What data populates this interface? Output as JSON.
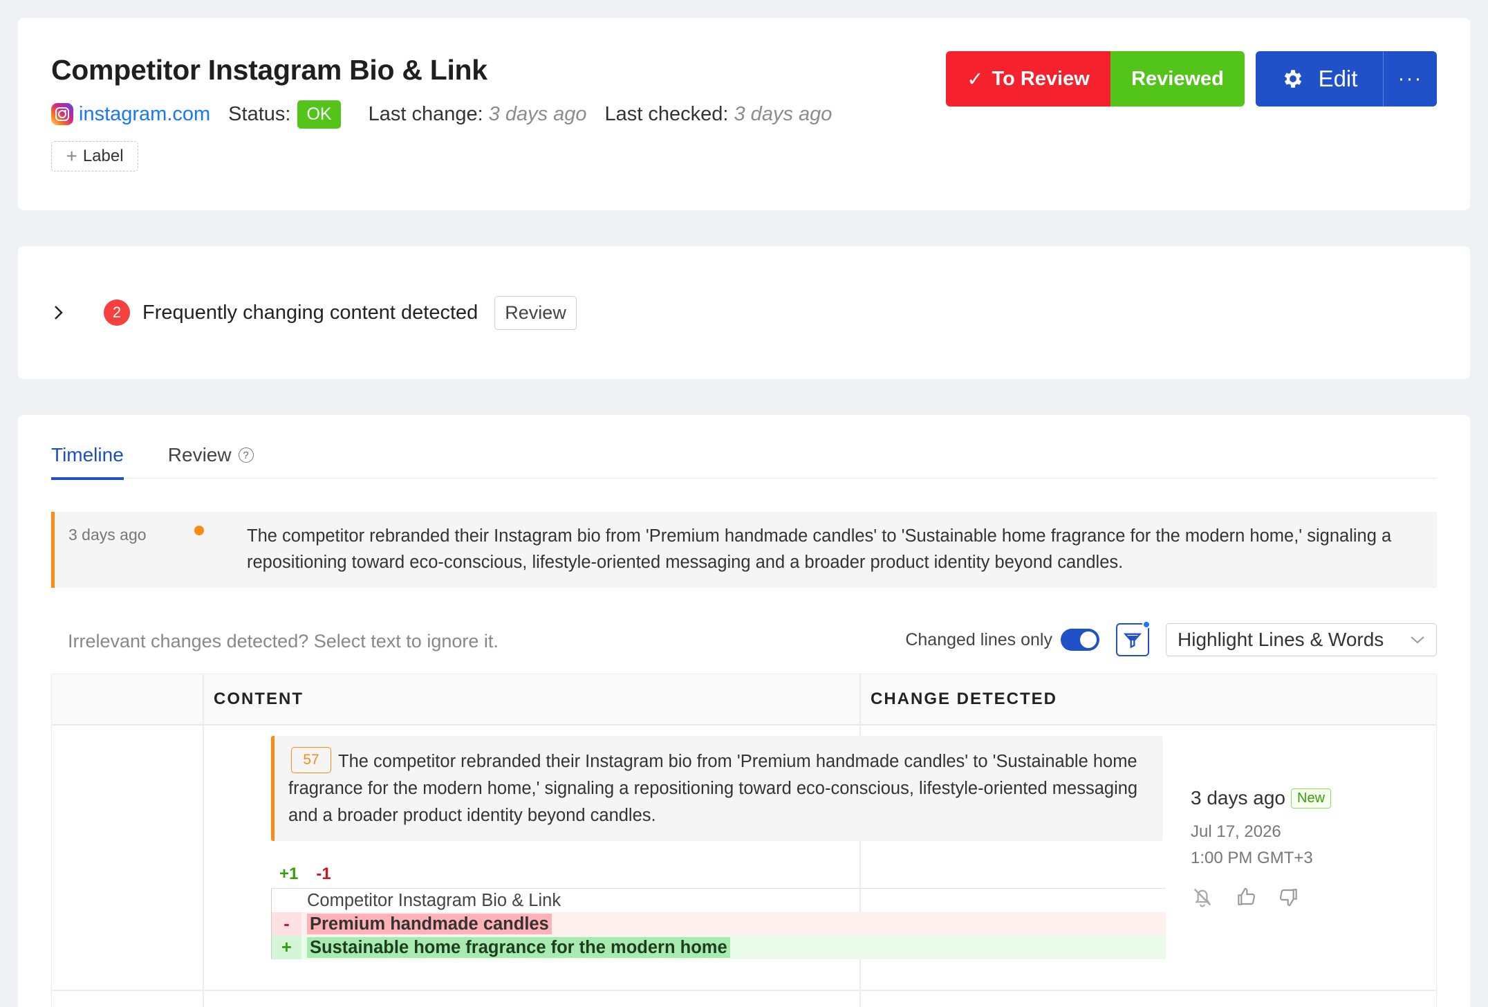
{
  "header": {
    "title": "Competitor Instagram Bio & Link",
    "site": "instagram.com",
    "status_label": "Status:",
    "status_value": "OK",
    "last_change_label": "Last change:",
    "last_change_value": "3 days ago",
    "last_checked_label": "Last checked:",
    "last_checked_value": "3 days ago",
    "label_button": "Label",
    "to_review_label": "To Review",
    "reviewed_label": "Reviewed",
    "edit_label": "Edit",
    "more_label": "···"
  },
  "warning": {
    "count": "2",
    "text": "Frequently changing content detected",
    "review_button": "Review"
  },
  "tabs": [
    {
      "label": "Timeline",
      "active": true
    },
    {
      "label": "Review",
      "active": false
    }
  ],
  "summary": {
    "time": "3 days ago",
    "text": "The competitor rebranded their Instagram bio from 'Premium handmade candles' to 'Sustainable home fragrance for the modern home,' signaling a repositioning toward eco-conscious, lifestyle-oriented messaging and a broader product identity beyond candles."
  },
  "toolbar": {
    "hint": "Irrelevant changes detected? Select text to ignore it.",
    "changed_lines_label": "Changed lines only",
    "changed_lines_on": true,
    "highlight_select": "Highlight Lines & Words"
  },
  "table": {
    "headers": {
      "col1": "",
      "content": "CONTENT",
      "change": "CHANGE DETECTED"
    },
    "row": {
      "importance": "57",
      "ai_summary": "The competitor rebranded their Instagram bio from 'Premium handmade candles' to 'Sustainable home fragrance for the modern home,' signaling a repositioning toward eco-conscious, lifestyle-oriented messaging and a broader product identity beyond candles.",
      "added_count": "+1",
      "removed_count": "-1",
      "diff": {
        "context": "Competitor Instagram Bio & Link",
        "removed_marker": "-",
        "removed": "Premium handmade candles",
        "added_marker": "+",
        "added": "Sustainable home fragrance for the modern home"
      },
      "change_when": "3 days ago",
      "new_badge": "New",
      "change_date": "Jul 17, 2026",
      "change_time": "1:00 PM GMT+3"
    }
  },
  "colors": {
    "to_review": "#f5222d",
    "reviewed": "#52c41a",
    "primary": "#2151c8",
    "accent_orange": "#fa8c16"
  }
}
